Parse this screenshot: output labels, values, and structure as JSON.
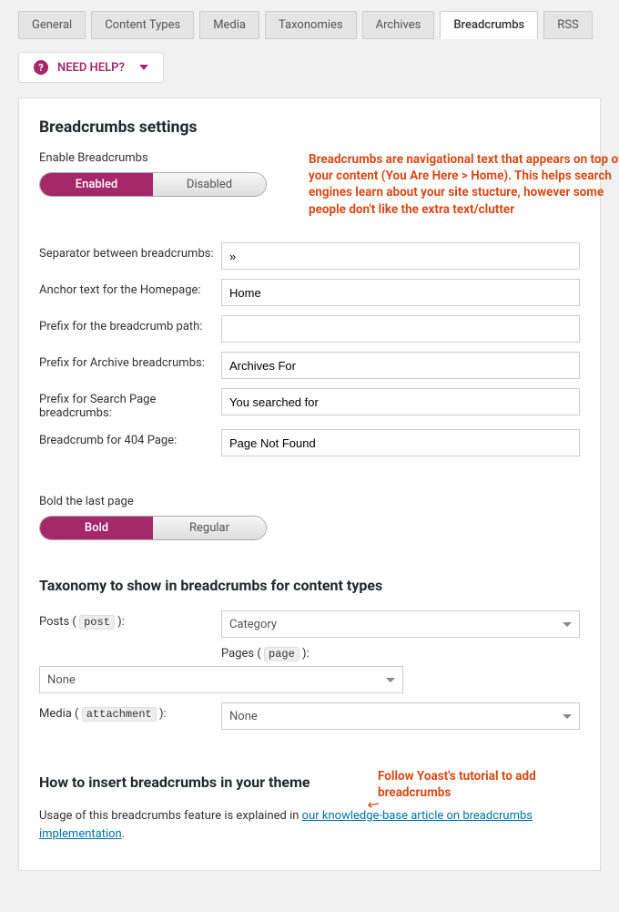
{
  "tabs": [
    "General",
    "Content Types",
    "Media",
    "Taxonomies",
    "Archives",
    "Breadcrumbs",
    "RSS"
  ],
  "active_tab": "Breadcrumbs",
  "need_help_label": "NEED HELP?",
  "section": {
    "title": "Breadcrumbs settings",
    "enable_label": "Enable Breadcrumbs",
    "toggle_enable": {
      "on": "Enabled",
      "off": "Disabled",
      "value": "on"
    },
    "annotation1": "Breadcrumbs are navigational text that appears on top of your content (You Are Here > Home). This helps search engines learn about your site stucture, however some people don't like the extra text/clutter",
    "fields": {
      "separator": {
        "label": "Separator between breadcrumbs:",
        "value": "»"
      },
      "anchor": {
        "label": "Anchor text for the Homepage:",
        "value": "Home"
      },
      "prefix_path": {
        "label": "Prefix for the breadcrumb path:",
        "value": ""
      },
      "prefix_archive": {
        "label": "Prefix for Archive breadcrumbs:",
        "value": "Archives For"
      },
      "prefix_search": {
        "label": "Prefix for Search Page breadcrumbs:",
        "value": "You searched for"
      },
      "crumb_404": {
        "label": "Breadcrumb for 404 Page:",
        "value": "Page Not Found"
      }
    },
    "bold_label": "Bold the last page",
    "toggle_bold": {
      "on": "Bold",
      "off": "Regular",
      "value": "on"
    }
  },
  "taxonomy": {
    "heading": "Taxonomy to show in breadcrumbs for content types",
    "posts_label_pre": "Posts ( ",
    "posts_code": "post",
    "posts_label_post": " ):",
    "posts_value": "Category",
    "pages_label_pre": "Pages ( ",
    "pages_code": "page",
    "pages_label_post": " ):",
    "pages_value_row_label": "None",
    "media_label_pre": "Media ( ",
    "media_code": "attachment",
    "media_label_post": " ):",
    "media_value": "None"
  },
  "insert": {
    "heading": "How to insert breadcrumbs in your theme",
    "annotation2": "Follow Yoast's tutorial to add breadcrumbs",
    "text_pre": "Usage of this breadcrumbs feature is explained in ",
    "link": "our knowledge-base article on breadcrumbs implementation",
    "text_post": "."
  }
}
